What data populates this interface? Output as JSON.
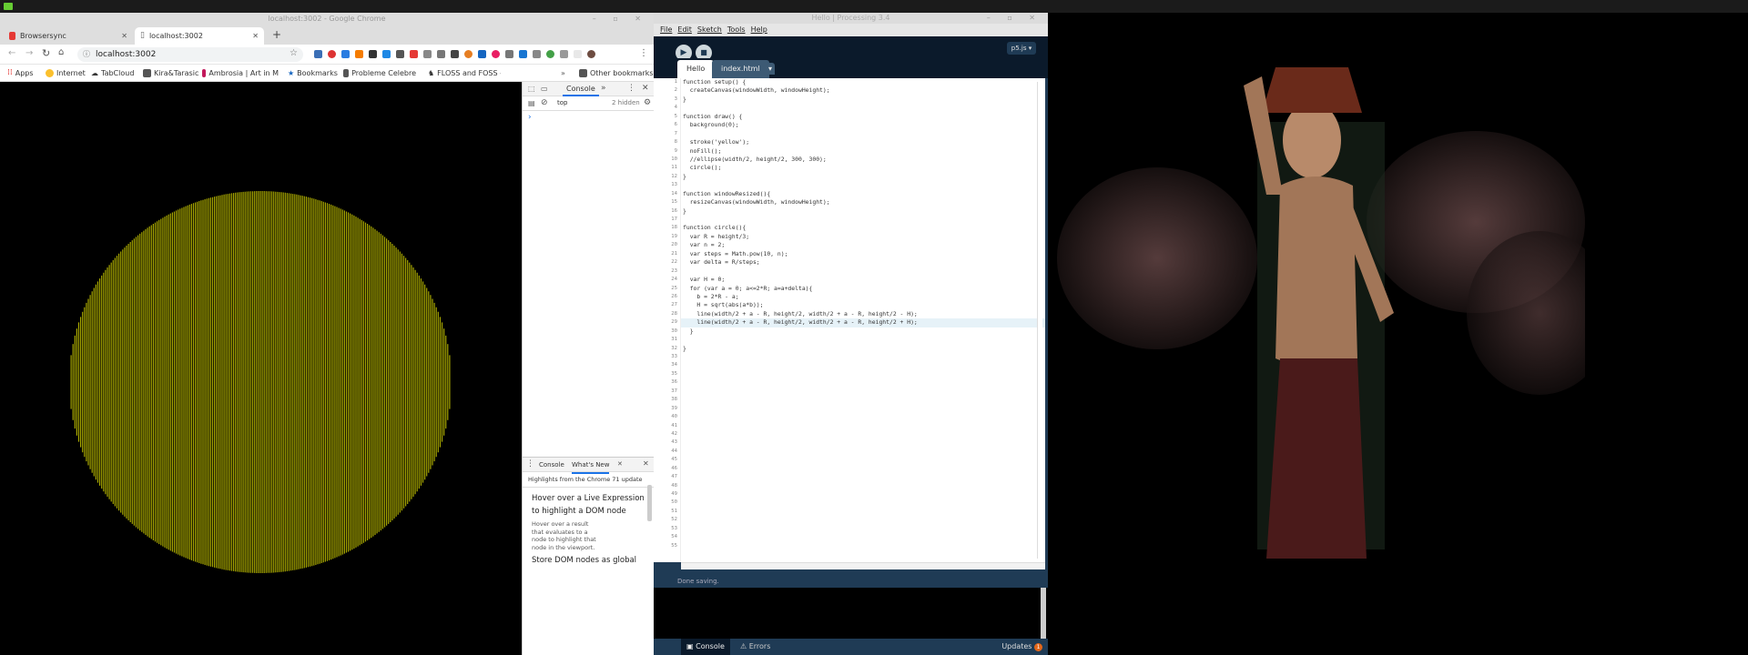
{
  "chrome": {
    "window_title": "localhost:3002 - Google Chrome",
    "tabs": [
      {
        "label": "Browsersync",
        "active": false
      },
      {
        "label": "localhost:3002",
        "active": true
      }
    ],
    "url": "localhost:3002",
    "bookmarks": [
      "Apps",
      "Internet",
      "TabCloud",
      "Kira&Tarasic",
      "Ambrosia | Art in M",
      "Bookmarks",
      "Probleme Celebre",
      "FLOSS and FOSS - C",
      "Other bookmarks"
    ],
    "overflow": "»"
  },
  "devtools": {
    "top_tab": "Console",
    "context": "top",
    "hidden": "2 hidden",
    "prompt": "›",
    "drawer_tabs": [
      "Console",
      "What's New"
    ],
    "whats_new_heading": "Highlights from the Chrome 71 update",
    "item1_title": "Hover over a Live Expression to highlight a DOM node",
    "item1_body": "Hover over a result that evaluates to a node to highlight that node in the viewport.",
    "item2_title": "Store DOM nodes as global"
  },
  "processing": {
    "window_title": "Hello | Processing 3.4",
    "menu": [
      "File",
      "Edit",
      "Sketch",
      "Tools",
      "Help"
    ],
    "mode": "p5.js ▾",
    "tabs": [
      "Hello",
      "index.html"
    ],
    "tab_menu": "▾",
    "status": "Done saving.",
    "bottom_console": "Console",
    "bottom_errors": "Errors",
    "updates": "Updates",
    "updates_count": "1"
  },
  "code_lines": [
    "function setup() {",
    "  createCanvas(windowWidth, windowHeight);",
    "}",
    "",
    "function draw() {",
    "  background(0);",
    "",
    "  stroke('yellow');",
    "  noFill();",
    "  //ellipse(width/2, height/2, 300, 300);",
    "  circle();",
    "}",
    "",
    "function windowResized(){",
    "  resizeCanvas(windowWidth, windowHeight);",
    "}",
    "",
    "function circle(){",
    "  var R = height/3;",
    "  var n = 2;",
    "  var steps = Math.pow(10, n);",
    "  var delta = R/steps;",
    "",
    "  var H = 0;",
    "  for (var a = 0; a<=2*R; a=a+delta){",
    "    b = 2*R - a;",
    "    H = sqrt(abs(a*b));",
    "    line(width/2 + a - R, height/2, width/2 + a - R, height/2 - H);",
    "    line(width/2 + a - R, height/2, width/2 + a - R, height/2 + H);",
    "  }",
    "",
    "}"
  ],
  "line_count": 55,
  "colors": {
    "circle_stroke": "#a8a800",
    "processing_bg": "#1f3b55",
    "processing_dark": "#0b1a2b"
  }
}
